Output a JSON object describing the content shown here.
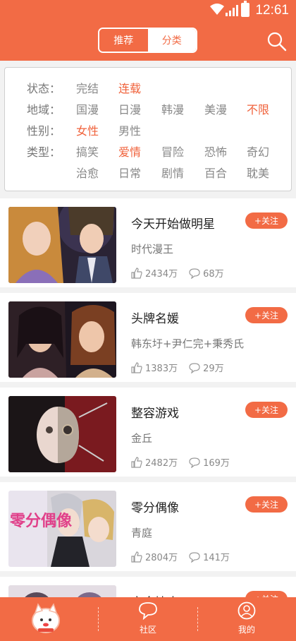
{
  "status_bar": {
    "time": "12:61"
  },
  "header": {
    "tabs": [
      {
        "label": "推荐"
      },
      {
        "label": "分类"
      }
    ]
  },
  "filters": {
    "status": {
      "label": "状态：",
      "options": [
        "完结",
        "连载"
      ],
      "selected": "连载"
    },
    "region": {
      "label": "地域：",
      "options": [
        "国漫",
        "日漫",
        "韩漫",
        "美漫",
        "不限"
      ],
      "selected": "不限"
    },
    "gender": {
      "label": "性别：",
      "options": [
        "女性",
        "男性"
      ],
      "selected": "女性"
    },
    "genre": {
      "label": "类型：",
      "options": [
        "搞笑",
        "爱情",
        "冒险",
        "恐怖",
        "奇幻",
        "治愈",
        "日常",
        "剧情",
        "百合",
        "耽美"
      ],
      "selected": "爱情"
    }
  },
  "comics": [
    {
      "title": "今天开始做明星",
      "author": "时代漫王",
      "likes": "2434万",
      "comments": "68万",
      "follow_label": "+关注"
    },
    {
      "title": "头牌名媛",
      "author": "韩东圩+尹仁完+秉秀氏",
      "likes": "1383万",
      "comments": "29万",
      "follow_label": "+关注"
    },
    {
      "title": "整容游戏",
      "author": "金丘",
      "likes": "2482万",
      "comments": "169万",
      "follow_label": "+关注"
    },
    {
      "title": "零分偶像",
      "author": "青庭",
      "likes": "2804万",
      "comments": "141万",
      "follow_label": "+关注"
    },
    {
      "title": "完全情人",
      "follow_label": "+关注"
    }
  ],
  "cover_texts": {
    "comic_4": "零分偶像"
  },
  "tabbar": {
    "items": [
      {
        "label": "",
        "icon": "mascot-icon"
      },
      {
        "label": "社区",
        "icon": "chat-bubble-icon"
      },
      {
        "label": "我的",
        "icon": "user-icon"
      }
    ]
  }
}
